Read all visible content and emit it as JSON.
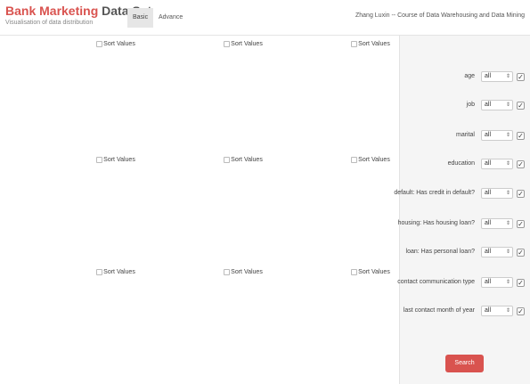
{
  "header": {
    "brand_red": "Bank Marketing",
    "brand_gray": "Data Set",
    "subtitle": "Visualisation of data distribution",
    "tabs": [
      {
        "label": "Basic"
      },
      {
        "label": "Advance"
      }
    ],
    "author": "Zhang Luxin -- Course of Data Warehousing and Data Mining"
  },
  "charts": [
    {
      "sort_label": "Sort Values",
      "sort_checked": false
    },
    {
      "sort_label": "Sort Values",
      "sort_checked": false
    },
    {
      "sort_label": "Sort Values",
      "sort_checked": false
    },
    {
      "sort_label": "Sort Values",
      "sort_checked": false
    },
    {
      "sort_label": "Sort Values",
      "sort_checked": false
    },
    {
      "sort_label": "Sort Values",
      "sort_checked": false
    },
    {
      "sort_label": "Sort Values",
      "sort_checked": false
    },
    {
      "sort_label": "Sort Values",
      "sort_checked": false
    },
    {
      "sort_label": "Sort Values",
      "sort_checked": false
    }
  ],
  "filters": [
    {
      "label": "age",
      "value": "all",
      "checked": true
    },
    {
      "label": "job",
      "value": "all",
      "checked": true
    },
    {
      "label": "marital",
      "value": "all",
      "checked": true
    },
    {
      "label": "education",
      "value": "all",
      "checked": true
    },
    {
      "label": "default: Has credit in default?",
      "value": "all",
      "checked": true
    },
    {
      "label": "housing: Has housing loan?",
      "value": "all",
      "checked": true
    },
    {
      "label": "loan: Has personal loan?",
      "value": "all",
      "checked": true
    },
    {
      "label": "contact communication type",
      "value": "all",
      "checked": true
    },
    {
      "label": "last contact month of year",
      "value": "all",
      "checked": true
    }
  ],
  "search_label": "Search",
  "colors": {
    "brand_red": "#d9534f",
    "search_button": "#d9534f",
    "sidebar_bg": "#f5f5f5"
  }
}
